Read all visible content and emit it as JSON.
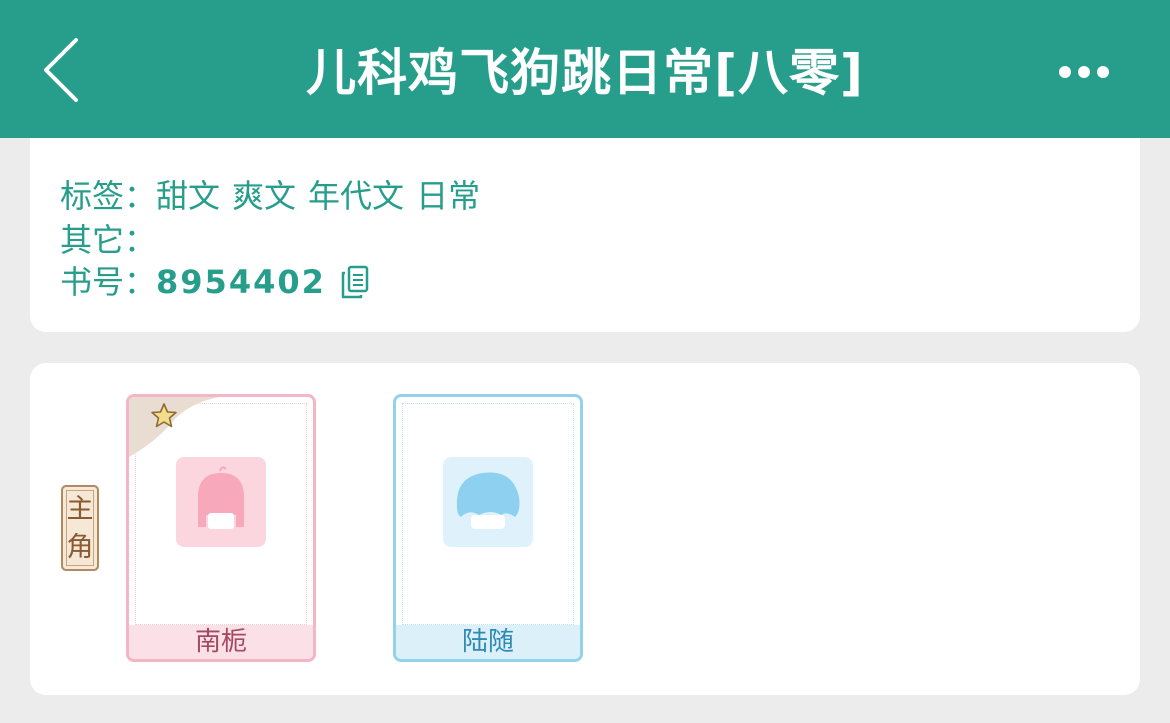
{
  "header": {
    "title": "儿科鸡飞狗跳日常[八零]",
    "background_color": "#279e8c",
    "back_icon": "chevron-left-icon",
    "more_icon": "more-horizontal-icon"
  },
  "info": {
    "tags_label": "标签：",
    "tags": [
      "甜文",
      "爽文",
      "年代文",
      "日常"
    ],
    "other_label": "其它：",
    "book_id_label": "书号：",
    "book_id": "8954402",
    "copy_icon": "copy-icon",
    "text_color": "#279e8c"
  },
  "characters": {
    "role_label_top": "主",
    "role_label_bottom": "角",
    "items": [
      {
        "name": "南栀",
        "theme": "pink",
        "starred": true
      },
      {
        "name": "陆随",
        "theme": "blue",
        "starred": false
      }
    ]
  }
}
